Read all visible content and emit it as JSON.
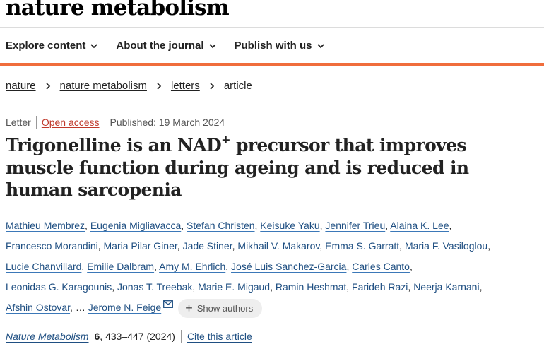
{
  "brand": {
    "name": "nature metabolism"
  },
  "nav": [
    {
      "label": "Explore content"
    },
    {
      "label": "About the journal"
    },
    {
      "label": "Publish with us"
    }
  ],
  "breadcrumb": [
    {
      "label": "nature"
    },
    {
      "label": "nature metabolism"
    },
    {
      "label": "letters"
    }
  ],
  "breadcrumb_current": "article",
  "meta": {
    "type": "Letter",
    "access": "Open access",
    "published": "Published: 19 March 2024"
  },
  "title": {
    "part1": "Trigonelline is an NAD",
    "sup": "+",
    "part2": " precursor that improves muscle function during ageing and is reduced in human sarcopenia"
  },
  "authors": [
    "Mathieu Membrez",
    "Eugenia Migliavacca",
    "Stefan Christen",
    "Keisuke Yaku",
    "Jennifer Trieu",
    "Alaina K. Lee",
    "Francesco Morandini",
    "Maria Pilar Giner",
    "Jade Stiner",
    "Mikhail V. Makarov",
    "Emma S. Garratt",
    "Maria F. Vasiloglou",
    "Lucie Chanvillard",
    "Emilie Dalbram",
    "Amy M. Ehrlich",
    "José Luis Sanchez-Garcia",
    "Carles Canto",
    "Leonidas G. Karagounis",
    "Jonas T. Treebak",
    "Marie E. Migaud",
    "Ramin Heshmat",
    "Farideh Razi",
    "Neerja Karnani",
    "Afshin Ostovar"
  ],
  "authors_ellipsis": "…",
  "corresponding_author": "Jerome N. Feige",
  "show_authors_label": "Show authors",
  "citation": {
    "journal": "Nature Metabolism",
    "volume": "6",
    "pages_year": ", 433–447 (2024)",
    "cite_label": "Cite this article"
  },
  "colors": {
    "accent": "#f06d3c",
    "link": "#1f4f82",
    "open_access": "#c0392b"
  }
}
